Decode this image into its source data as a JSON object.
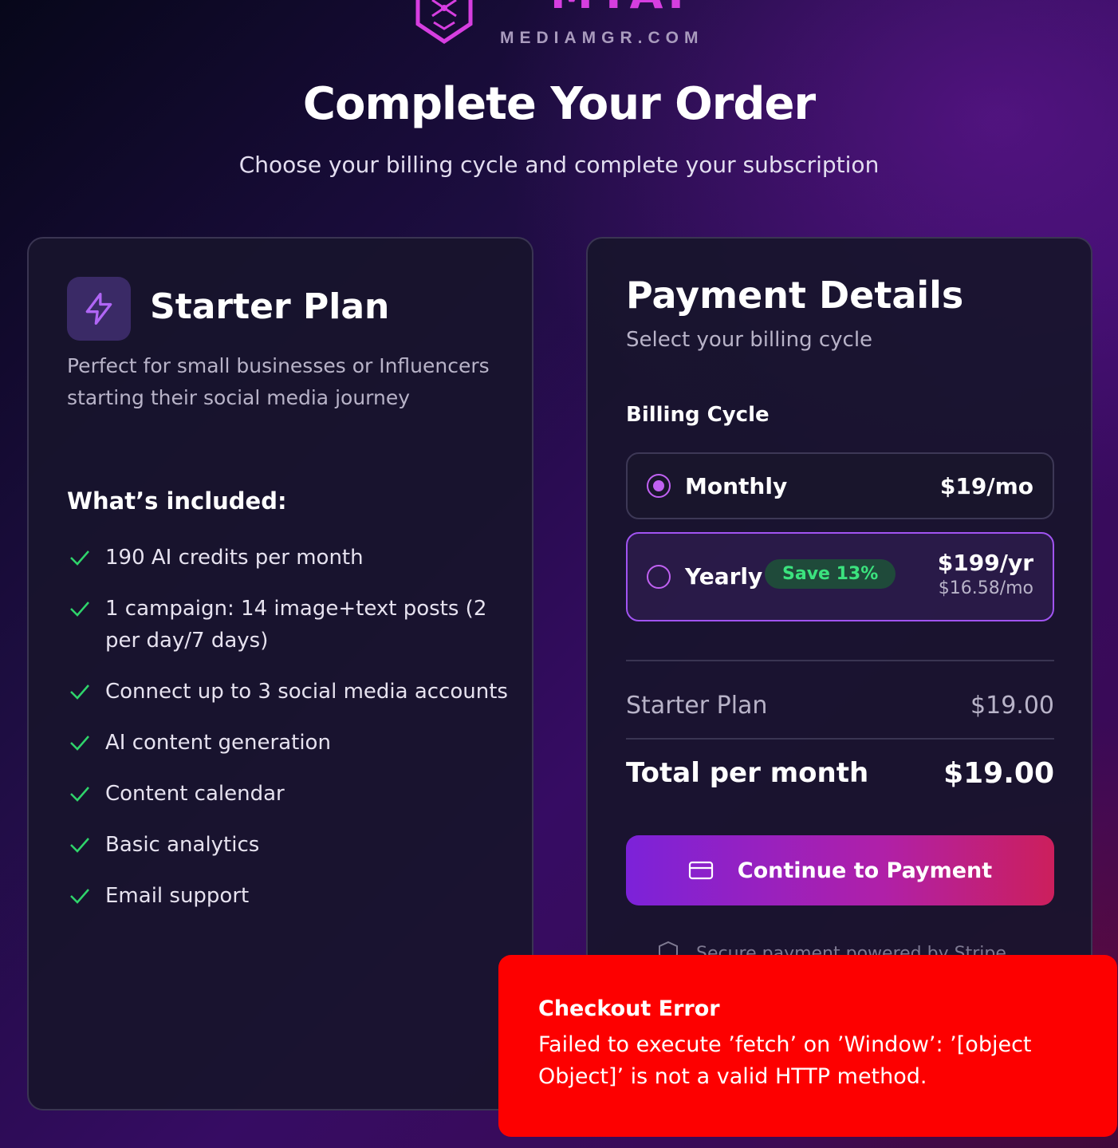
{
  "brand": {
    "name": "MYAI",
    "domain": "MEDIAMGR.COM"
  },
  "page": {
    "title": "Complete Your Order",
    "subtitle": "Choose your billing cycle and complete your subscription"
  },
  "plan": {
    "name": "Starter Plan",
    "description": "Perfect for small businesses or Influencers starting their social media journey",
    "included_heading": "What’s included:",
    "features": [
      "190 AI credits per month",
      "1 campaign: 14 image+text posts (2 per day/7 days)",
      "Connect up to 3 social media accounts",
      "AI content generation",
      "Content calendar",
      "Basic analytics",
      "Email support"
    ]
  },
  "payment": {
    "title": "Payment Details",
    "subtitle": "Select your billing cycle",
    "billing_label": "Billing Cycle",
    "options": [
      {
        "label": "Monthly",
        "price": "$19/mo",
        "selected": true
      },
      {
        "label": "Yearly",
        "badge": "Save 13%",
        "price": "$199/yr",
        "sub_price": "$16.58/mo",
        "selected": false
      }
    ],
    "summary": {
      "plan_label": "Starter Plan",
      "plan_value": "$19.00",
      "total_label": "Total per month",
      "total_value": "$19.00"
    },
    "button_label": "Continue to Payment",
    "secure_text": "Secure payment powered by Stripe"
  },
  "error_toast": {
    "title": "Checkout Error",
    "message": "Failed to execute ’fetch’ on ’Window’: ’[object Object]’ is not a valid HTTP method."
  },
  "colors": {
    "accent_purple": "#c061f2",
    "check_green": "#2fd46b",
    "save_badge_bg": "#1f4a3a",
    "save_badge_text": "#3be37e",
    "error_red": "#fd0000",
    "brand_magenta": "#d63ee0"
  }
}
